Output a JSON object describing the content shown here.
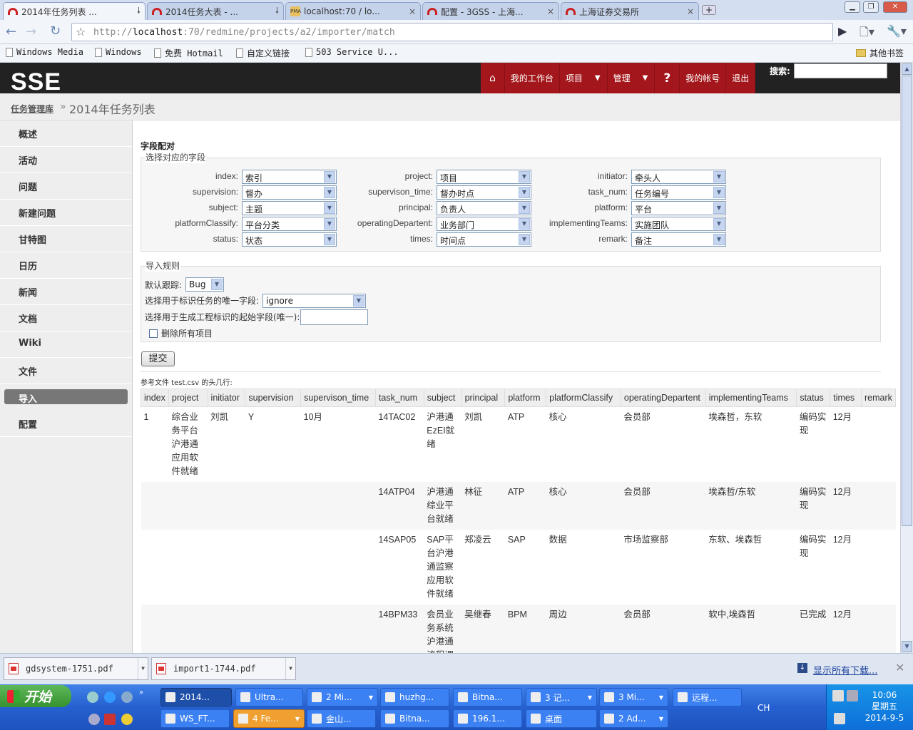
{
  "browser": {
    "tabs": [
      {
        "title": "2014年任务列表 ...",
        "active": true
      },
      {
        "title": "2014任务大表 - ..."
      },
      {
        "title": "localhost:70 / lo..."
      },
      {
        "title": "配置 - 3GSS - 上海..."
      },
      {
        "title": "上海证券交易所"
      }
    ],
    "url_prefix": "http://",
    "url_host": "localhost",
    "url_rest": ":70/redmine/projects/a2/importer/match",
    "bookmarks": [
      "Windows Media",
      "Windows",
      "免费 Hotmail",
      "自定义链接",
      "503 Service U..."
    ],
    "other_bookmarks": "其他书签"
  },
  "app": {
    "logo": "SSE",
    "menu": [
      "我的工作台",
      "项目",
      "管理",
      "?",
      "我的帐号",
      "退出"
    ],
    "search_label": "搜索:",
    "breadcrumb_root": "任务管理库",
    "breadcrumb_sep": "»",
    "page_title": "2014年任务列表",
    "sidebar": [
      "概述",
      "活动",
      "问题",
      "新建问题",
      "甘特图",
      "日历",
      "新闻",
      "文档",
      "Wiki",
      "文件",
      "导入",
      "配置"
    ],
    "sidebar_selected": "导入"
  },
  "form": {
    "section_title": "字段配对",
    "mapping_legend": "选择对应的字段",
    "mappings": [
      {
        "label": "index:",
        "value": "索引"
      },
      {
        "label": "project:",
        "value": "项目"
      },
      {
        "label": "initiator:",
        "value": "牵头人"
      },
      {
        "label": "supervision:",
        "value": "督办"
      },
      {
        "label": "supervison_time:",
        "value": "督办时点"
      },
      {
        "label": "task_num:",
        "value": "任务编号"
      },
      {
        "label": "subject:",
        "value": "主题"
      },
      {
        "label": "principal:",
        "value": "负责人"
      },
      {
        "label": "platform:",
        "value": "平台"
      },
      {
        "label": "platformClassify:",
        "value": "平台分类"
      },
      {
        "label": "operatingDepartent:",
        "value": "业务部门"
      },
      {
        "label": "implementingTeams:",
        "value": "实施团队"
      },
      {
        "label": "status:",
        "value": "状态"
      },
      {
        "label": "times:",
        "value": "时间点"
      },
      {
        "label": "remark:",
        "value": "备注"
      }
    ],
    "rules_legend": "导入规则",
    "default_tracker_label": "默认跟踪:",
    "default_tracker_value": "Bug",
    "unique_field_label": "选择用于标识任务的唯一字段:",
    "unique_field_value": "ignore",
    "start_field_label": "选择用于生成工程标识的起始字段(唯一):",
    "start_field_value": "",
    "delete_all_label": "删除所有项目",
    "submit_label": "提交"
  },
  "csv": {
    "note": "参考文件 test.csv 的头几行:",
    "headers": [
      "index",
      "project",
      "initiator",
      "supervision",
      "supervison_time",
      "task_num",
      "subject",
      "principal",
      "platform",
      "platformClassify",
      "operatingDepartent",
      "implementingTeams",
      "status",
      "times",
      "remark"
    ],
    "rows": [
      [
        "1",
        "综合业务平台沪港通应用软件就绪",
        "刘凯",
        "Y",
        "10月",
        "14TAC02",
        "沪港通EzEI就绪",
        "刘凯",
        "ATP",
        "核心",
        "会员部",
        "埃森哲，东软",
        "编码实现",
        "12月",
        ""
      ],
      [
        "",
        "",
        "",
        "",
        "",
        "14ATP04",
        "沪港通综业平台就绪",
        "林征",
        "ATP",
        "核心",
        "会员部",
        "埃森哲/东软",
        "编码实现",
        "12月",
        ""
      ],
      [
        "",
        "",
        "",
        "",
        "",
        "14SAP05",
        "SAP平台沪港通监察应用软件就绪",
        "郑凌云",
        "SAP",
        "数据",
        "市场监察部",
        "东软、埃森哲",
        "编码实现",
        "12月",
        ""
      ],
      [
        "",
        "",
        "",
        "",
        "",
        "14BPM33",
        "会员业务系统沪港通流程调整优化",
        "吴继春",
        "BPM",
        "周边",
        "会员部",
        "软中,埃森哲",
        "已完成",
        "12月",
        ""
      ]
    ]
  },
  "downloads": {
    "files": [
      "gdsystem-1751.pdf",
      "import1-1744.pdf"
    ],
    "show_all": "显示所有下载..."
  },
  "taskbar": {
    "start": "开始",
    "row1": [
      {
        "label": "2014...",
        "active": true
      },
      {
        "label": "Ultra..."
      },
      {
        "label": "2 Mi...",
        "group": true
      },
      {
        "label": "huzhg..."
      },
      {
        "label": "Bitna..."
      },
      {
        "label": "3 记...",
        "group": true
      },
      {
        "label": "3 Mi...",
        "group": true
      },
      {
        "label": "远程..."
      }
    ],
    "row2": [
      {
        "label": "WS_FT..."
      },
      {
        "label": "4 Fe...",
        "group": true,
        "highlight": true
      },
      {
        "label": "金山..."
      },
      {
        "label": "Bitna..."
      },
      {
        "label": "196.1..."
      },
      {
        "label": "桌面"
      },
      {
        "label": "2 Ad...",
        "group": true
      }
    ],
    "ime": "CH",
    "time": "10:06",
    "weekday": "星期五",
    "date": "2014-9-5"
  }
}
